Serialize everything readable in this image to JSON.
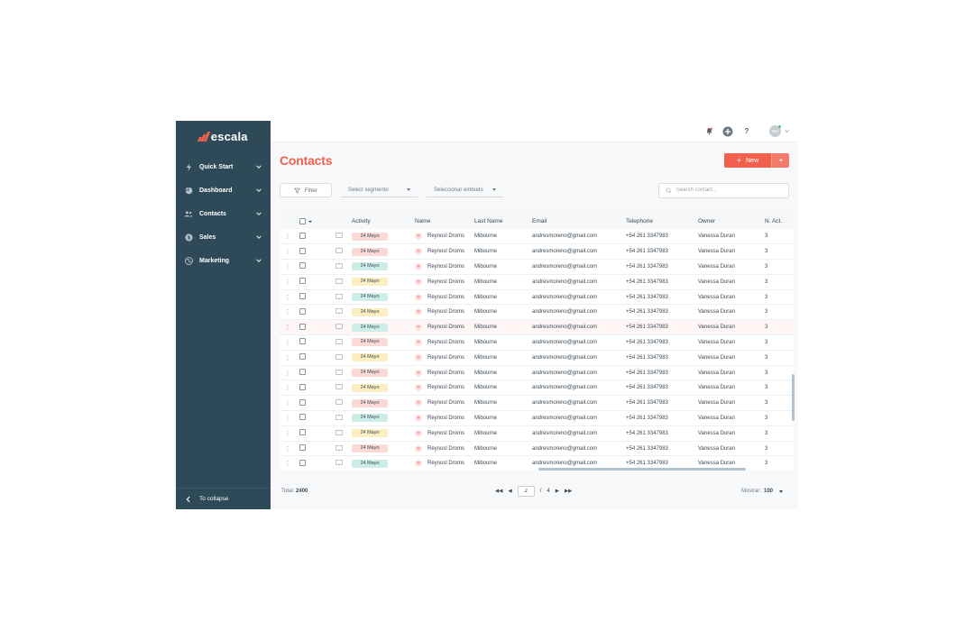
{
  "brand": {
    "name": "escala",
    "accent": "#f0604c",
    "sidebar_bg": "#2e4a58"
  },
  "sidebar": {
    "items": [
      {
        "label": "Quick Start",
        "icon": "lightning-icon"
      },
      {
        "label": "Dashboard",
        "icon": "pie-chart-icon"
      },
      {
        "label": "Contacts",
        "icon": "users-icon"
      },
      {
        "label": "Sales",
        "icon": "dollar-icon"
      },
      {
        "label": "Marketing",
        "icon": "globe-icon"
      }
    ],
    "collapse_label": "To collapse"
  },
  "topbar": {
    "help": "?",
    "avatar_initials": "RM"
  },
  "page": {
    "title": "Contacts",
    "new_label": "New"
  },
  "filters": {
    "filter_label": "Filter",
    "segment_placeholder": "Select segmento",
    "funnel_placeholder": "Seleccionar embudo",
    "search_placeholder": "Search contact..."
  },
  "table": {
    "columns": [
      "Activity",
      "Name",
      "Last Name",
      "Email",
      "Telephone",
      "Owner",
      "N. Act."
    ],
    "rows": [
      {
        "activity": "24 Mayo",
        "status": "red",
        "name": "Reynosl Droms",
        "last_name": "Mibourne",
        "email": "andresmoreno@gmail.com",
        "telephone": "+54 261 3347983",
        "owner": "Vanessa Duran",
        "n_act": "3"
      },
      {
        "activity": "24 Mayo",
        "status": "red",
        "name": "Reynosl Droms",
        "last_name": "Mibourne",
        "email": "andresmoreno@gmail.com",
        "telephone": "+54 261 3347983",
        "owner": "Vanessa Duran",
        "n_act": "3"
      },
      {
        "activity": "24 Mayo",
        "status": "green",
        "name": "Reynosl Droms",
        "last_name": "Mibourne",
        "email": "andresmoreno@gmail.com",
        "telephone": "+54 261 3347983",
        "owner": "Vanessa Duran",
        "n_act": "3"
      },
      {
        "activity": "24 Mayo",
        "status": "yellow",
        "name": "Reynosl Droms",
        "last_name": "Mibourne",
        "email": "andresmoreno@gmail.com",
        "telephone": "+54 261 3347983",
        "owner": "Vanessa Duran",
        "n_act": "3"
      },
      {
        "activity": "24 Mayo",
        "status": "green",
        "name": "Reynosl Droms",
        "last_name": "Mibourne",
        "email": "andresmoreno@gmail.com",
        "telephone": "+54 261 3347983",
        "owner": "Vanessa Duran",
        "n_act": "3"
      },
      {
        "activity": "24 Mayo",
        "status": "yellow",
        "name": "Reynosl Droms",
        "last_name": "Mibourne",
        "email": "andresmoreno@gmail.com",
        "telephone": "+54 261 3347983",
        "owner": "Vanessa Duran",
        "n_act": "3"
      },
      {
        "activity": "24 Mayo",
        "status": "green",
        "name": "Reynosl Droms",
        "last_name": "Mibourne",
        "email": "andresmoreno@gmail.com",
        "telephone": "+54 261 3347983",
        "owner": "Vanessa Duran",
        "n_act": "3",
        "highlight": true
      },
      {
        "activity": "24 Mayo",
        "status": "red",
        "name": "Reynosl Droms",
        "last_name": "Mibourne",
        "email": "andresmoreno@gmail.com",
        "telephone": "+54 261 3347983",
        "owner": "Vanessa Duran",
        "n_act": "3"
      },
      {
        "activity": "24 Mayo",
        "status": "yellow",
        "name": "Reynosl Droms",
        "last_name": "Mibourne",
        "email": "andresmoreno@gmail.com",
        "telephone": "+54 261 3347983",
        "owner": "Vanessa Duran",
        "n_act": "3"
      },
      {
        "activity": "24 Mayo",
        "status": "red",
        "name": "Reynosl Droms",
        "last_name": "Mibourne",
        "email": "andresmoreno@gmail.com",
        "telephone": "+54 261 3347983",
        "owner": "Vanessa Duran",
        "n_act": "3"
      },
      {
        "activity": "24 Mayo",
        "status": "yellow",
        "name": "Reynosl Droms",
        "last_name": "Mibourne",
        "email": "andresmoreno@gmail.com",
        "telephone": "+54 261 3347983",
        "owner": "Vanessa Duran",
        "n_act": "3"
      },
      {
        "activity": "24 Mayo",
        "status": "red",
        "name": "Reynosl Droms",
        "last_name": "Mibourne",
        "email": "andresmoreno@gmail.com",
        "telephone": "+54 261 3347983",
        "owner": "Vanessa Duran",
        "n_act": "3"
      },
      {
        "activity": "24 Mayo",
        "status": "green",
        "name": "Reynosl Droms",
        "last_name": "Mibourne",
        "email": "andresmoreno@gmail.com",
        "telephone": "+54 261 3347983",
        "owner": "Vanessa Duran",
        "n_act": "3"
      },
      {
        "activity": "24 Mayo",
        "status": "yellow",
        "name": "Reynosl Droms",
        "last_name": "Mibourne",
        "email": "andresmoreno@gmail.com",
        "telephone": "+54 261 3347983",
        "owner": "Vanessa Duran",
        "n_act": "3"
      },
      {
        "activity": "24 Mayo",
        "status": "red",
        "name": "Reynosl Droms",
        "last_name": "Mibourne",
        "email": "andresmoreno@gmail.com",
        "telephone": "+54 261 3347983",
        "owner": "Vanessa Duran",
        "n_act": "3"
      },
      {
        "activity": "24 Mayo",
        "status": "green",
        "name": "Reynosl Droms",
        "last_name": "Mibourne",
        "email": "andresmoreno@gmail.com",
        "telephone": "+54 261 3347983",
        "owner": "Vanessa Duran",
        "n_act": "3"
      }
    ]
  },
  "footer": {
    "total_label": "Total:",
    "total_value": "2400",
    "current_page": "2",
    "page_separator": "/",
    "total_pages": "4",
    "show_label": "Mostrar:",
    "show_value": "100"
  }
}
